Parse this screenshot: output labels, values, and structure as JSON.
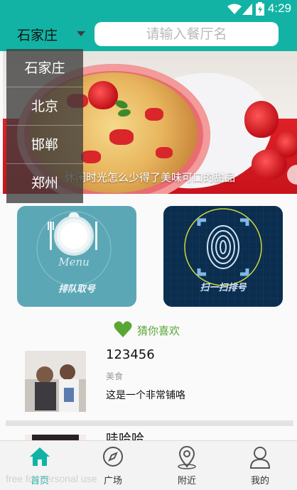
{
  "status_bar": {
    "time": "4:29"
  },
  "header": {
    "city": "石家庄",
    "search_placeholder": "请输入餐厅名"
  },
  "city_dropdown": {
    "options": [
      "石家庄",
      "北京",
      "邯郸",
      "郑州"
    ]
  },
  "banner": {
    "caption": "休闲时光怎么少得了美味可口的甜品",
    "page_count": 5,
    "active_page": 1
  },
  "features": {
    "queue_label": "排队取号",
    "plate_text": "Menu",
    "scan_label": "扫一扫排号"
  },
  "guess": {
    "title": "猜你喜欢",
    "items": [
      {
        "name": "123456",
        "category": "美食",
        "description": "这是一个非常铺咯"
      },
      {
        "name": "哇哈哈"
      }
    ]
  },
  "bottom_nav": {
    "tabs": [
      "首页",
      "广场",
      "附近",
      "我的"
    ],
    "active": 0
  },
  "watermark": "free for personal use",
  "colors": {
    "primary": "#12b3a4",
    "accent_green": "#5aa635"
  }
}
